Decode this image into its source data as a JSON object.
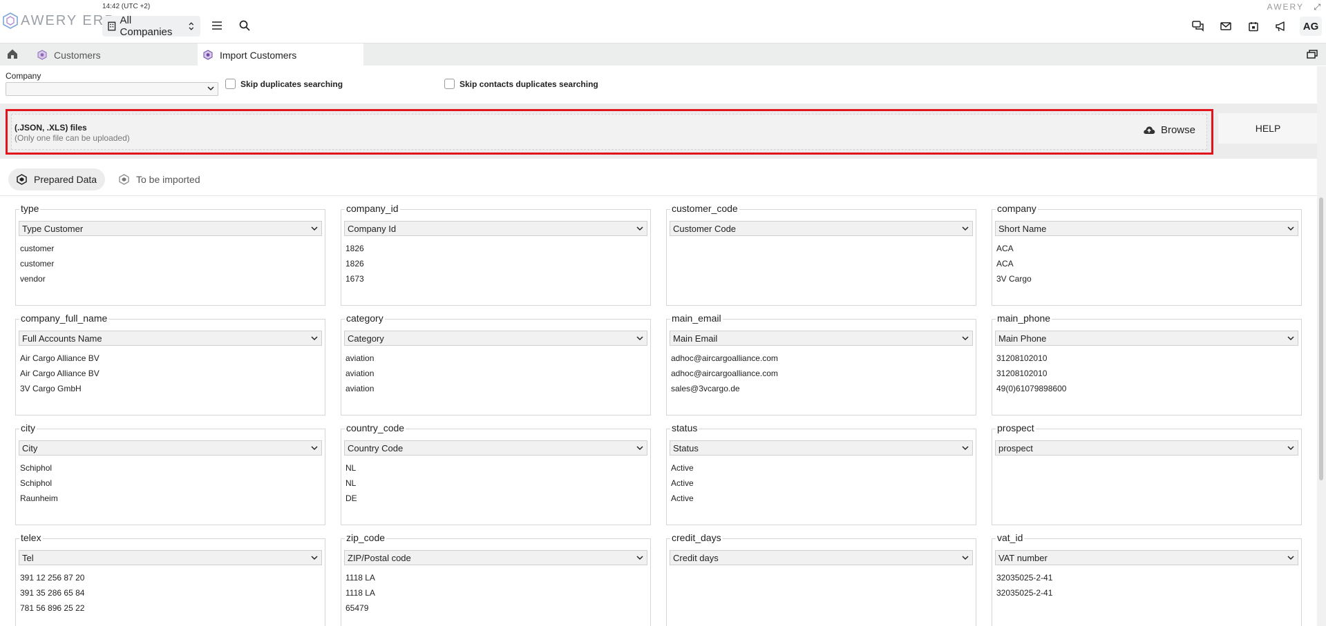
{
  "header": {
    "time": "14:42 (UTC +2)",
    "logo_text": "AWERY ERP",
    "company_selector": "All Companies",
    "brand_right": "AWERY",
    "avatar": "AG"
  },
  "tabs": [
    {
      "label": "Customers"
    },
    {
      "label": "Import Customers"
    }
  ],
  "filters": {
    "company_label": "Company",
    "company_value": "",
    "skip_duplicates": "Skip duplicates searching",
    "skip_contacts_duplicates": "Skip contacts duplicates searching"
  },
  "upload": {
    "title": "(.JSON, .XLS) files",
    "subtitle": "(Only one file can be uploaded)",
    "browse": "Browse",
    "help": "HELP"
  },
  "subtabs": {
    "prepared": "Prepared Data",
    "to_be_imported": "To be imported"
  },
  "fields": [
    {
      "name": "type",
      "mapping": "Type Customer",
      "values": [
        "customer",
        "customer",
        "vendor"
      ]
    },
    {
      "name": "company_id",
      "mapping": "Company Id",
      "values": [
        "1826",
        "1826",
        "1673"
      ]
    },
    {
      "name": "customer_code",
      "mapping": "Customer Code",
      "values": []
    },
    {
      "name": "company",
      "mapping": "Short Name",
      "values": [
        "ACA",
        "ACA",
        "3V Cargo"
      ]
    },
    {
      "name": "company_full_name",
      "mapping": "Full Accounts Name",
      "values": [
        "Air Cargo Alliance BV",
        "Air Cargo Alliance BV",
        "3V Cargo GmbH"
      ]
    },
    {
      "name": "category",
      "mapping": "Category",
      "values": [
        "aviation",
        "aviation",
        "aviation"
      ]
    },
    {
      "name": "main_email",
      "mapping": "Main Email",
      "values": [
        "adhoc@aircargoalliance.com",
        "adhoc@aircargoalliance.com",
        "sales@3vcargo.de"
      ]
    },
    {
      "name": "main_phone",
      "mapping": "Main Phone",
      "values": [
        "31208102010",
        "31208102010",
        "49(0)61079898600"
      ]
    },
    {
      "name": "city",
      "mapping": "City",
      "values": [
        "Schiphol",
        "Schiphol",
        "Raunheim"
      ]
    },
    {
      "name": "country_code",
      "mapping": "Country Code",
      "values": [
        "NL",
        "NL",
        "DE"
      ]
    },
    {
      "name": "status",
      "mapping": "Status",
      "values": [
        "Active",
        "Active",
        "Active"
      ]
    },
    {
      "name": "prospect",
      "mapping": "prospect",
      "values": []
    },
    {
      "name": "telex",
      "mapping": "Tel",
      "values": [
        "391 12 256 87 20",
        "391 35 286 65 84",
        "781 56 896 25 22"
      ]
    },
    {
      "name": "zip_code",
      "mapping": "ZIP/Postal code",
      "values": [
        "1118 LA",
        "1118 LA",
        "65479"
      ]
    },
    {
      "name": "credit_days",
      "mapping": "Credit days",
      "values": []
    },
    {
      "name": "vat_id",
      "mapping": "VAT number",
      "values": [
        "32035025-2-41",
        "32035025-2-41"
      ]
    }
  ]
}
